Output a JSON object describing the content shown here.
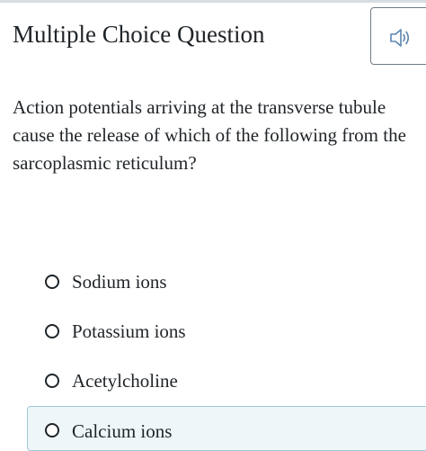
{
  "header": {
    "title": "Multiple Choice Question"
  },
  "audio_button": {
    "icon": "speaker-icon"
  },
  "question": {
    "text": "Action potentials arriving at the transverse tubule cause the release of which of the following from the sarcoplasmic reticulum?"
  },
  "choices": [
    {
      "label": "Sodium ions"
    },
    {
      "label": "Potassium ions"
    },
    {
      "label": "Acetylcholine"
    },
    {
      "label": "Calcium ions"
    }
  ],
  "colors": {
    "text": "#1f2428",
    "highlight_background": "#eef6f8",
    "highlight_border": "#9cc9d5",
    "button_border": "#6f7c87"
  }
}
